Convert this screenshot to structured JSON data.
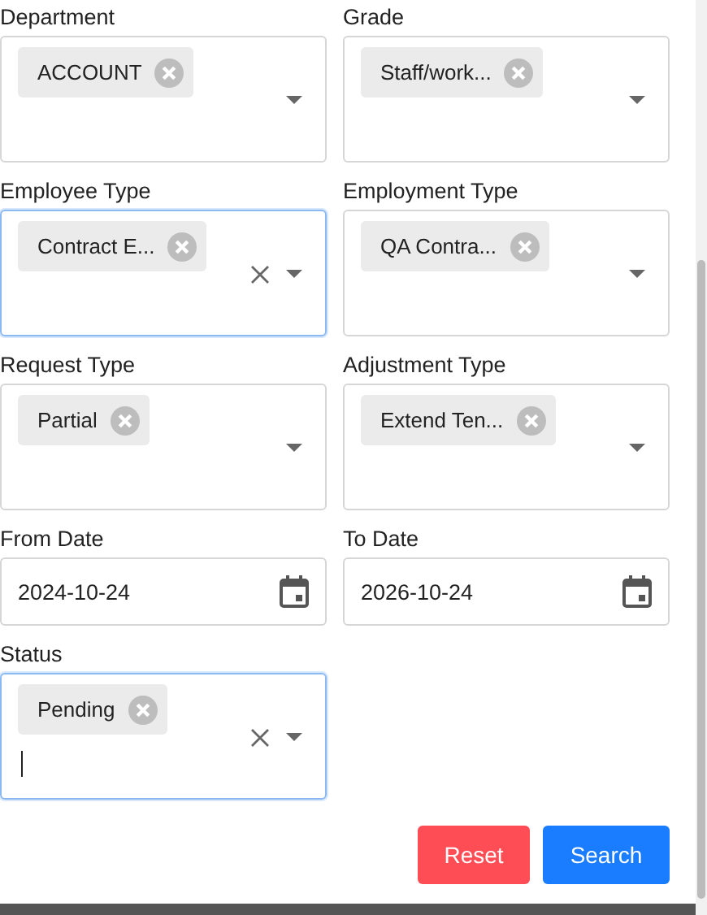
{
  "fields": [
    {
      "kind": "multiselect",
      "label": "Department",
      "tags": [
        "ACCOUNT"
      ],
      "focused": false,
      "typing": false
    },
    {
      "kind": "multiselect",
      "label": "Grade",
      "tags": [
        "Staff/work..."
      ],
      "focused": false,
      "typing": false
    },
    {
      "kind": "multiselect",
      "label": "Employee Type",
      "tags": [
        "Contract E..."
      ],
      "focused": true,
      "typing": false
    },
    {
      "kind": "multiselect",
      "label": "Employment Type",
      "tags": [
        "QA Contra..."
      ],
      "focused": false,
      "typing": false
    },
    {
      "kind": "multiselect",
      "label": "Request Type",
      "tags": [
        "Partial"
      ],
      "focused": false,
      "typing": false
    },
    {
      "kind": "multiselect",
      "label": "Adjustment Type",
      "tags": [
        "Extend Ten..."
      ],
      "focused": false,
      "typing": false
    },
    {
      "kind": "date",
      "label": "From Date",
      "value": "2024-10-24"
    },
    {
      "kind": "date",
      "label": "To Date",
      "value": "2026-10-24"
    },
    {
      "kind": "multiselect",
      "label": "Status",
      "tags": [
        "Pending"
      ],
      "focused": true,
      "typing": true
    }
  ],
  "buttons": [
    {
      "kind": "reset",
      "label": "Reset"
    },
    {
      "kind": "search",
      "label": "Search"
    }
  ]
}
